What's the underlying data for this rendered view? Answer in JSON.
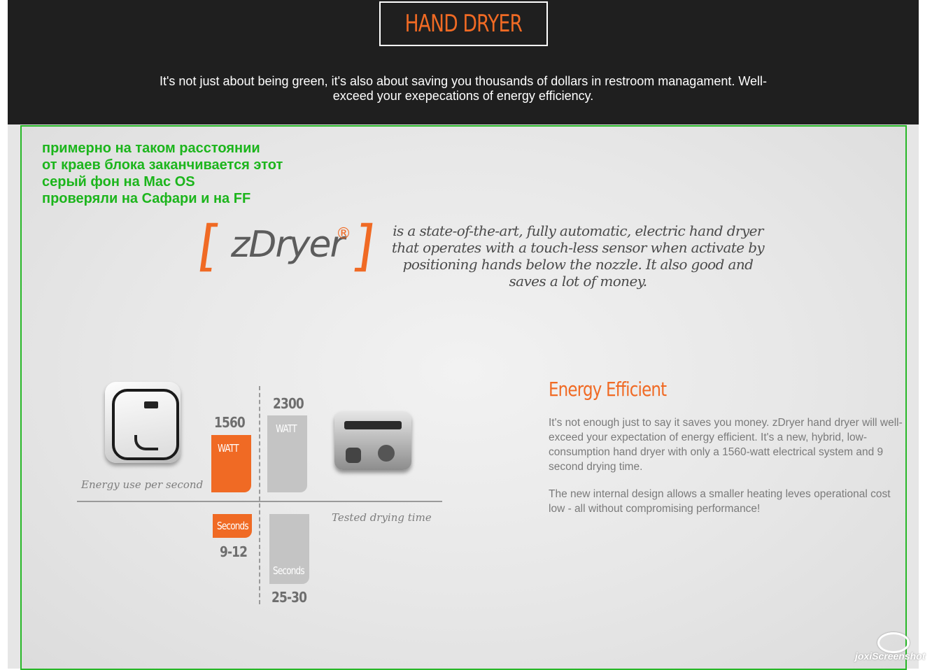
{
  "header": {
    "title": "HAND DRYER",
    "tagline": "It's not just about being green, it's also about saving you thousands of dollars in restroom managament. Well-exceed your exepecations of energy efficiency."
  },
  "note": {
    "lines": [
      " примерно на таком расстоянии",
      "от краев блока заканчивается этот",
      "серый фон на Mac OS",
      "проверяли на Сафари и на FF"
    ]
  },
  "brand": {
    "bracket_left": "[",
    "bracket_right": "]",
    "name": "zDryer",
    "registered": "®",
    "description": "is a state-of-the-art, fully automatic, electric hand dryer that operates with a touch-less sensor when activate by positioning hands below the nozzle. It also good and saves a lot of money."
  },
  "infographic": {
    "caption_energy": "Energy use per second",
    "caption_time": "Tested drying time",
    "zdryer_watt": "1560",
    "other_watt": "2300",
    "watt_label": "WATT",
    "zdryer_seconds": "9-12",
    "other_seconds": "25-30",
    "seconds_label": "Seconds"
  },
  "energy": {
    "title": "Energy Efficient",
    "para1": "It's not enough just to say it saves you money. zDryer hand dryer will well-exceed your expectation of energy efficient. It's a new, hybrid, low-consumption hand dryer with only a 1560-watt electrical system and 9 second drying time.",
    "para2": "The new internal design allows a smaller heating leves operational cost low - all without compromising performance!"
  },
  "watermark": {
    "text": "joxiScreenshot"
  },
  "colors": {
    "accent": "#f06a24",
    "header_bg": "#1f1f1f",
    "note_green": "#1cb51c",
    "border_green": "#27b727"
  }
}
